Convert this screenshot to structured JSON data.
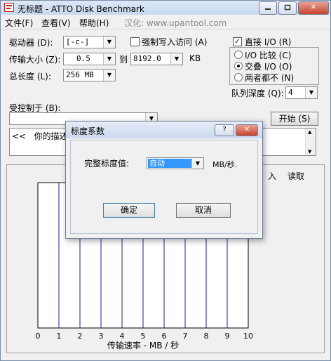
{
  "window": {
    "title": "无标题 - ATTO Disk Benchmark",
    "caption_min": "▭",
    "caption_max": "□",
    "caption_close": "✕"
  },
  "menu": [
    "文件(F)",
    "查看(V)",
    "帮助(H)",
    "汉化: www.upantool.com"
  ],
  "settings": {
    "drive_label": "驱动器 (D):",
    "drive_value": "[-c-]",
    "transfer_label": "传输大小 (Z):",
    "transfer_from": "0.5",
    "to_label": "到",
    "transfer_to": "8192.0",
    "kb_label": "KB",
    "total_label": "总长度 (L):",
    "total_value": "256 MB",
    "force_write_label": "强制写入访问 (A)",
    "force_write_checked": false,
    "direct_io_label": "直接 I/O (R)",
    "direct_io_checked": true,
    "io_compare_label": "I/O 比较 (C)",
    "overlapped_io_label": "交叠 I/O (O)",
    "neither_label": "两者都不 (N)",
    "queue_depth_label": "队列深度 (Q):",
    "queue_depth_value": "4",
    "controlled_by_label": "受控制于 (B):",
    "controlled_by_value": "",
    "start_button": "开始 (S)",
    "description_text": "<<   你的描述"
  },
  "chart": {
    "legend_read": "读取",
    "legend_write_partial": "入",
    "xlabel": "传输速率 - MB / 秒",
    "x_ticks": [
      "0",
      "1",
      "2",
      "3",
      "4",
      "5",
      "6",
      "7",
      "8",
      "9",
      "10"
    ]
  },
  "chart_data": {
    "type": "bar",
    "title": "",
    "xlabel": "传输速率 - MB / 秒",
    "ylabel": "",
    "xlim": [
      0,
      10
    ],
    "x_ticks": [
      0,
      1,
      2,
      3,
      4,
      5,
      6,
      7,
      8,
      9,
      10
    ],
    "series": [],
    "grid": true,
    "legend": [
      "入",
      "读取"
    ]
  },
  "dialog": {
    "title": "标度系数",
    "help": "?",
    "close": "✕",
    "scale_label": "完整标度值:",
    "scale_value": "自动",
    "unit": "MB/秒.",
    "ok_button": "确定",
    "cancel_button": "取消"
  }
}
